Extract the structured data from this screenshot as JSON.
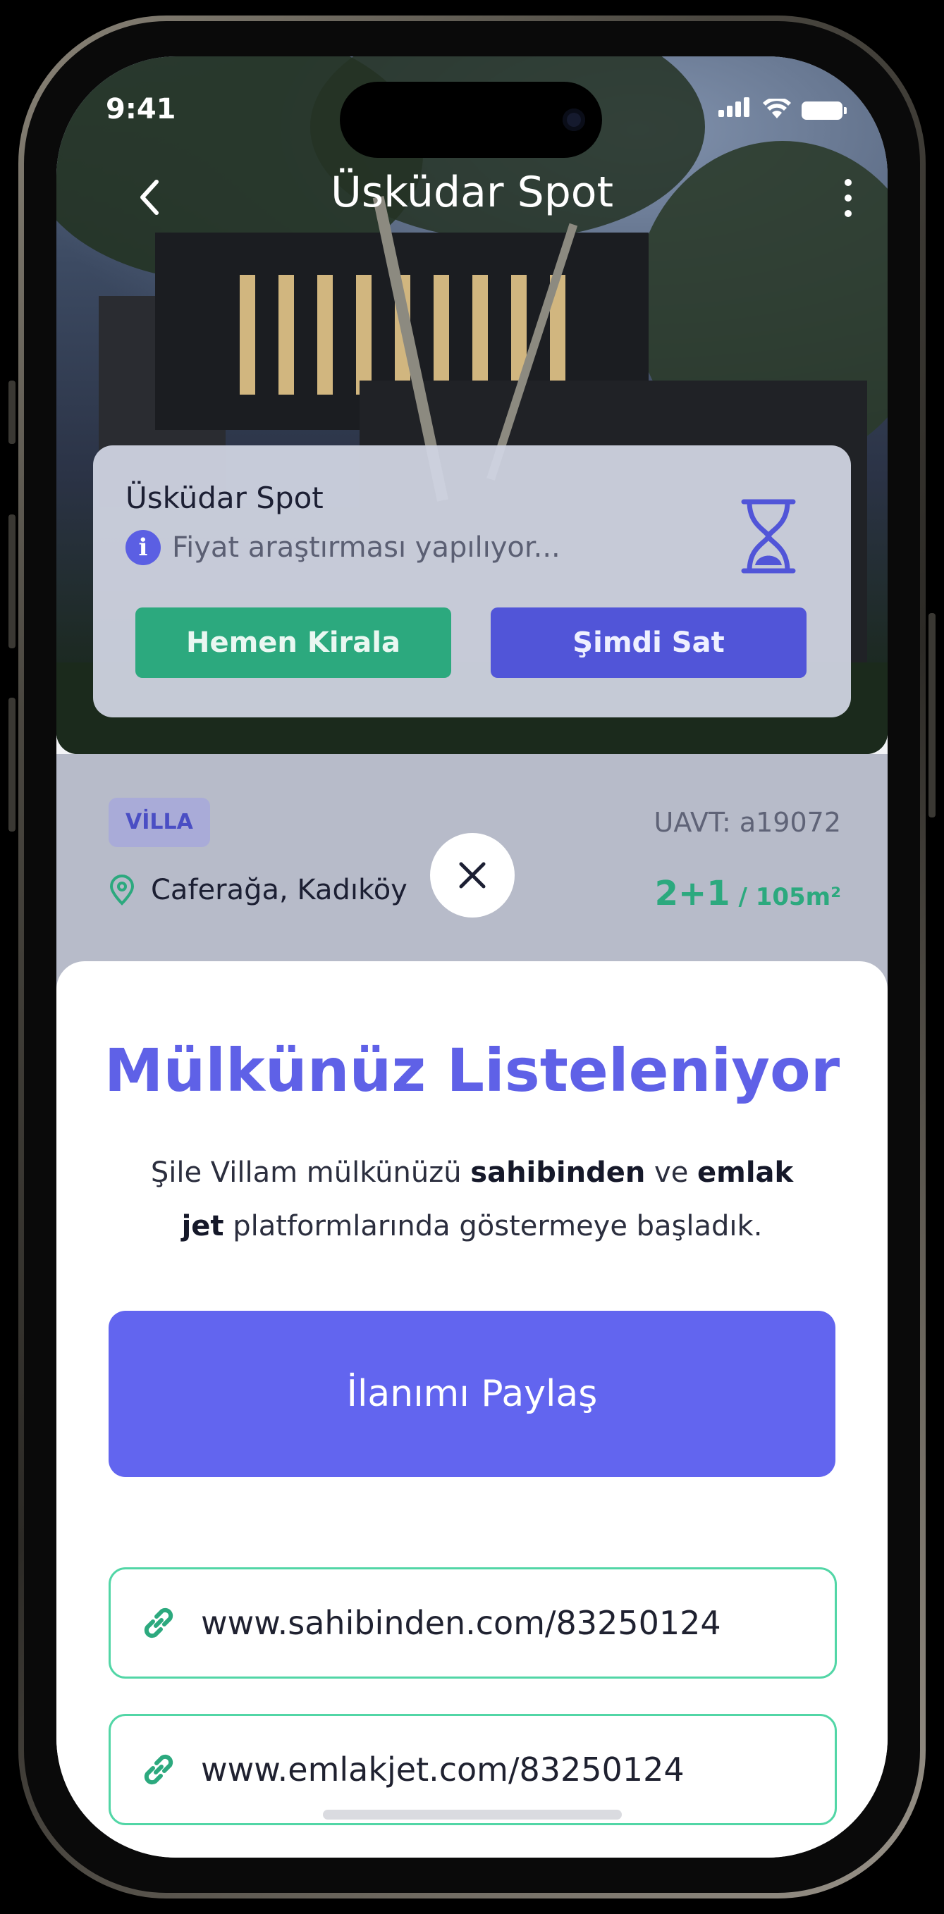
{
  "status_bar": {
    "time": "9:41"
  },
  "nav": {
    "title": "Üsküdar Spot"
  },
  "info_card": {
    "title": "Üsküdar Spot",
    "subtitle": "Fiyat araştırması yapılıyor...",
    "rent_button": "Hemen Kirala",
    "sell_button": "Şimdi Sat"
  },
  "property": {
    "type_badge": "VİLLA",
    "uavt": "UAVT: a19072",
    "location": "Caferağa, Kadıköy",
    "rooms": "2+1",
    "area": " / 105m²"
  },
  "sheet": {
    "title": "Mülkünüz Listeleniyor",
    "desc_part1": "Şile Villam mülkünüzü ",
    "desc_bold1": "sahibinden",
    "desc_part2": " ve ",
    "desc_bold2": "emlak jet",
    "desc_part3": " platformlarında göstermeye başladık.",
    "share_button": "İlanımı Paylaş",
    "links": [
      "www.sahibinden.com/83250124",
      "www.emlakjet.com/83250124"
    ]
  },
  "colors": {
    "primary": "#6265ef",
    "green": "#2ca97e",
    "link_border": "#52d6a6"
  },
  "icons": [
    "back-chevron-icon",
    "more-vertical-icon",
    "info-icon",
    "hourglass-icon",
    "location-pin-icon",
    "close-icon",
    "link-icon"
  ]
}
